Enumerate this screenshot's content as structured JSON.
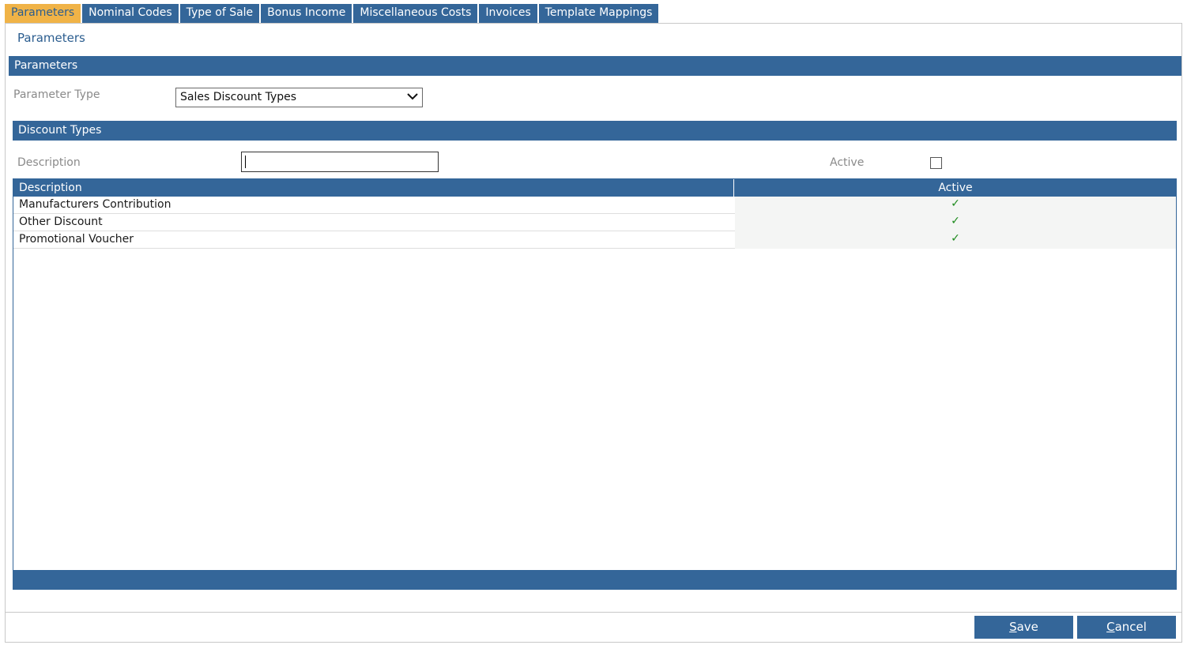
{
  "tabs": [
    {
      "label": "Parameters",
      "active": true
    },
    {
      "label": "Nominal Codes",
      "active": false
    },
    {
      "label": "Type of Sale",
      "active": false
    },
    {
      "label": "Bonus Income",
      "active": false
    },
    {
      "label": "Miscellaneous Costs",
      "active": false
    },
    {
      "label": "Invoices",
      "active": false
    },
    {
      "label": "Template Mappings",
      "active": false
    }
  ],
  "page": {
    "title": "Parameters"
  },
  "parameters_section": {
    "header": "Parameters",
    "parameter_type_label": "Parameter Type",
    "parameter_type_value": "Sales Discount Types"
  },
  "discount_section": {
    "header": "Discount Types",
    "description_label": "Description",
    "description_value": "",
    "active_label": "Active",
    "active_checked": false
  },
  "grid": {
    "columns": [
      "Description",
      "Active"
    ],
    "rows": [
      {
        "description": "Manufacturers Contribution",
        "active": "✓"
      },
      {
        "description": "Other Discount",
        "active": "✓"
      },
      {
        "description": "Promotional Voucher",
        "active": "✓"
      }
    ]
  },
  "buttons": {
    "save_first": "S",
    "save_rest": "ave",
    "cancel_first": "C",
    "cancel_rest": "ancel"
  },
  "colors": {
    "primary": "#346699",
    "active_tab": "#f0b347",
    "check": "#1c8a1c"
  }
}
